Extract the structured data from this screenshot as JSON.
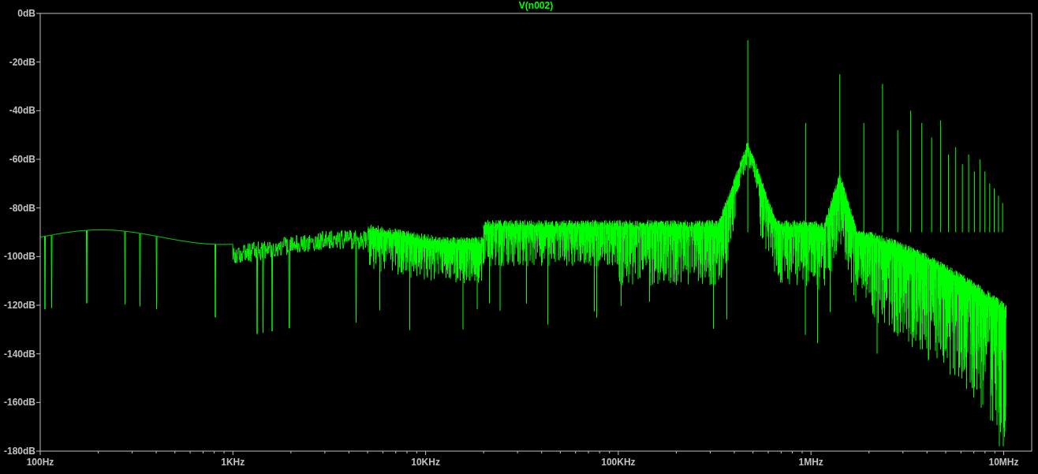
{
  "plot": {
    "trace_name": "V(n002)",
    "y_axis_labels": [
      "0dB",
      "-20dB",
      "-40dB",
      "-60dB",
      "-80dB",
      "-100dB",
      "-120dB",
      "-140dB",
      "-160dB",
      "-180dB"
    ],
    "x_axis_labels": [
      "100Hz",
      "1KHz",
      "10KHz",
      "100KHz",
      "1MHz",
      "10MHz"
    ]
  }
}
